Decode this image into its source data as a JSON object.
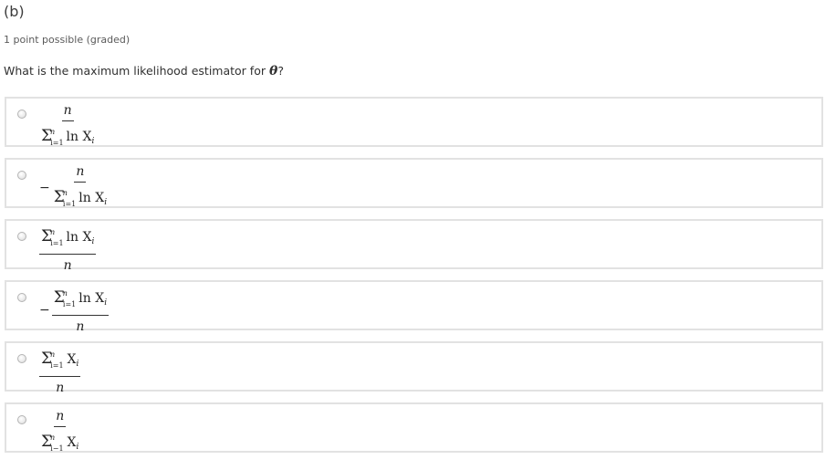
{
  "problem": {
    "part_label": "(b)",
    "points": "1 point possible (graded)",
    "question_text": "What is the maximum likelihood estimator for",
    "question_symbol": "θ",
    "question_end": "?"
  },
  "options": [
    {
      "negative": "",
      "numerator": "n",
      "denominator_sum": "Σ",
      "denominator_sup": "n",
      "denominator_sub": "i=1",
      "denominator_rest": "ln X",
      "denominator_index": "i"
    },
    {
      "negative": "−",
      "numerator": "n",
      "denominator_sum": "Σ",
      "denominator_sup": "n",
      "denominator_sub": "i=1",
      "denominator_rest": "ln X",
      "denominator_index": "i"
    },
    {
      "negative": "",
      "numerator_sum": "Σ",
      "numerator_sup": "n",
      "numerator_sub": "i=1",
      "numerator_rest": "ln X",
      "numerator_index": "i",
      "denominator": "n"
    },
    {
      "negative": "−",
      "numerator_sum": "Σ",
      "numerator_sup": "n",
      "numerator_sub": "i=1",
      "numerator_rest": "ln X",
      "numerator_index": "i",
      "denominator": "n"
    },
    {
      "negative": "",
      "numerator_sum": "Σ",
      "numerator_sup": "n",
      "numerator_sub": "i=1",
      "numerator_rest": "X",
      "numerator_index": "i",
      "denominator": "n"
    },
    {
      "negative": "",
      "numerator": "n",
      "denominator_sum": "Σ",
      "denominator_sup": "n",
      "denominator_sub": "i−1",
      "denominator_rest": "X",
      "denominator_index": "i"
    }
  ]
}
